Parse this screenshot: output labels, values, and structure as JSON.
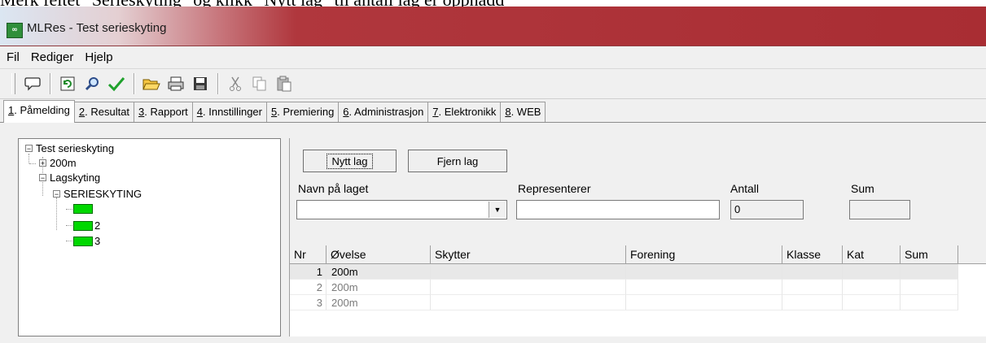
{
  "caption": "Merk feltet \"Serieskyting\" og klikk \"Nytt lag\" til antall lag er oppnådd",
  "window": {
    "title": "MLRes - Test serieskyting"
  },
  "menu": [
    "Fil",
    "Rediger",
    "Hjelp"
  ],
  "toolbar": {
    "icons": [
      "speech-bubble-icon",
      "refresh-icon",
      "search-icon",
      "checkmark-icon",
      "open-folder-icon",
      "print-icon",
      "save-icon",
      "cut-icon",
      "copy-icon",
      "paste-icon"
    ]
  },
  "tabs": [
    {
      "key": "1",
      "label": ". Påmelding"
    },
    {
      "key": "2",
      "label": ". Resultat"
    },
    {
      "key": "3",
      "label": ". Rapport"
    },
    {
      "key": "4",
      "label": ". Innstillinger"
    },
    {
      "key": "5",
      "label": ". Premiering"
    },
    {
      "key": "6",
      "label": ". Administrasjon"
    },
    {
      "key": "7",
      "label": ". Elektronikk"
    },
    {
      "key": "8",
      "label": ". WEB"
    }
  ],
  "tree": {
    "root": "Test serieskyting",
    "item_200m": "200m",
    "item_lagskyting": "Lagskyting",
    "item_serieskyting": "SERIESKYTING",
    "teams": [
      "",
      "2",
      "3"
    ]
  },
  "form": {
    "new_team_button": "Nytt lag",
    "remove_team_button": "Fjern lag",
    "team_name_label": "Navn på laget",
    "team_name_value": "",
    "represents_label": "Representerer",
    "represents_value": "",
    "count_label": "Antall",
    "count_value": "0",
    "sum_label": "Sum",
    "sum_value": ""
  },
  "grid": {
    "columns": [
      "Nr",
      "Øvelse",
      "Skytter",
      "Forening",
      "Klasse",
      "Kat",
      "Sum"
    ],
    "rows": [
      {
        "nr": "1",
        "ovelse": "200m",
        "skytter": "",
        "forening": "",
        "klasse": "",
        "kat": "",
        "sum": ""
      },
      {
        "nr": "2",
        "ovelse": "200m",
        "skytter": "",
        "forening": "",
        "klasse": "",
        "kat": "",
        "sum": ""
      },
      {
        "nr": "3",
        "ovelse": "200m",
        "skytter": "",
        "forening": "",
        "klasse": "",
        "kat": "",
        "sum": ""
      }
    ]
  }
}
